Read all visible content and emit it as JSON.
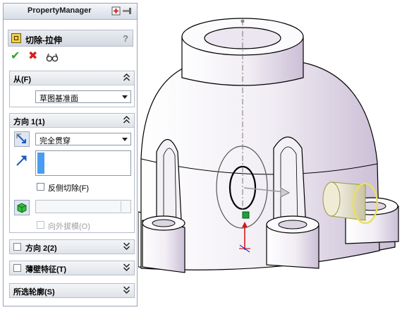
{
  "panel": {
    "title": "PropertyManager",
    "feature_name": "切除-拉伸",
    "help": "?",
    "actions": [
      {
        "name": "ok",
        "symbol": "✔",
        "color": "#2aa52a"
      },
      {
        "name": "cancel",
        "symbol": "✖",
        "color": "#d42020"
      },
      {
        "name": "preview",
        "symbol": "66"
      }
    ]
  },
  "from_group": {
    "label": "从(F)",
    "state": "expanded",
    "select_value": "草图基准面"
  },
  "direction1_group": {
    "label": "方向 1(1)",
    "state": "expanded",
    "end_condition": "完全贯穿",
    "flip_side_label": "反侧切除(F)",
    "flip_side_checked": false,
    "draft_label": "向外拔模(O)",
    "draft_enabled": false
  },
  "direction2_group": {
    "label": "方向 2(2)",
    "checked": false,
    "state": "collapsed"
  },
  "thin_group": {
    "label": "薄壁特征(T)",
    "checked": false,
    "state": "collapsed"
  },
  "contours_group": {
    "label": "所选轮廓(S)",
    "state": "collapsed"
  },
  "colors": {
    "panel_border": "#9aa4b3",
    "selection_strip": "#4a9cf0",
    "model_body": "#f2eef5",
    "model_shadow": "#c9bcd3",
    "preview_yellow": "#e8e060",
    "cut_circle": "#000000"
  }
}
